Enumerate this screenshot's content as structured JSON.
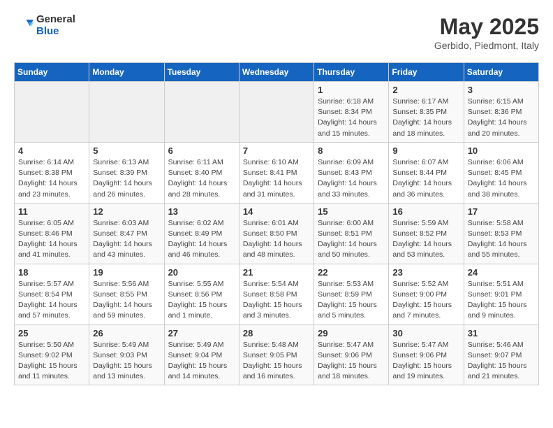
{
  "logo": {
    "general": "General",
    "blue": "Blue"
  },
  "title": "May 2025",
  "subtitle": "Gerbido, Piedmont, Italy",
  "days_of_week": [
    "Sunday",
    "Monday",
    "Tuesday",
    "Wednesday",
    "Thursday",
    "Friday",
    "Saturday"
  ],
  "weeks": [
    [
      {
        "day": "",
        "info": ""
      },
      {
        "day": "",
        "info": ""
      },
      {
        "day": "",
        "info": ""
      },
      {
        "day": "",
        "info": ""
      },
      {
        "day": "1",
        "info": "Sunrise: 6:18 AM\nSunset: 8:34 PM\nDaylight: 14 hours\nand 15 minutes."
      },
      {
        "day": "2",
        "info": "Sunrise: 6:17 AM\nSunset: 8:35 PM\nDaylight: 14 hours\nand 18 minutes."
      },
      {
        "day": "3",
        "info": "Sunrise: 6:15 AM\nSunset: 8:36 PM\nDaylight: 14 hours\nand 20 minutes."
      }
    ],
    [
      {
        "day": "4",
        "info": "Sunrise: 6:14 AM\nSunset: 8:38 PM\nDaylight: 14 hours\nand 23 minutes."
      },
      {
        "day": "5",
        "info": "Sunrise: 6:13 AM\nSunset: 8:39 PM\nDaylight: 14 hours\nand 26 minutes."
      },
      {
        "day": "6",
        "info": "Sunrise: 6:11 AM\nSunset: 8:40 PM\nDaylight: 14 hours\nand 28 minutes."
      },
      {
        "day": "7",
        "info": "Sunrise: 6:10 AM\nSunset: 8:41 PM\nDaylight: 14 hours\nand 31 minutes."
      },
      {
        "day": "8",
        "info": "Sunrise: 6:09 AM\nSunset: 8:43 PM\nDaylight: 14 hours\nand 33 minutes."
      },
      {
        "day": "9",
        "info": "Sunrise: 6:07 AM\nSunset: 8:44 PM\nDaylight: 14 hours\nand 36 minutes."
      },
      {
        "day": "10",
        "info": "Sunrise: 6:06 AM\nSunset: 8:45 PM\nDaylight: 14 hours\nand 38 minutes."
      }
    ],
    [
      {
        "day": "11",
        "info": "Sunrise: 6:05 AM\nSunset: 8:46 PM\nDaylight: 14 hours\nand 41 minutes."
      },
      {
        "day": "12",
        "info": "Sunrise: 6:03 AM\nSunset: 8:47 PM\nDaylight: 14 hours\nand 43 minutes."
      },
      {
        "day": "13",
        "info": "Sunrise: 6:02 AM\nSunset: 8:49 PM\nDaylight: 14 hours\nand 46 minutes."
      },
      {
        "day": "14",
        "info": "Sunrise: 6:01 AM\nSunset: 8:50 PM\nDaylight: 14 hours\nand 48 minutes."
      },
      {
        "day": "15",
        "info": "Sunrise: 6:00 AM\nSunset: 8:51 PM\nDaylight: 14 hours\nand 50 minutes."
      },
      {
        "day": "16",
        "info": "Sunrise: 5:59 AM\nSunset: 8:52 PM\nDaylight: 14 hours\nand 53 minutes."
      },
      {
        "day": "17",
        "info": "Sunrise: 5:58 AM\nSunset: 8:53 PM\nDaylight: 14 hours\nand 55 minutes."
      }
    ],
    [
      {
        "day": "18",
        "info": "Sunrise: 5:57 AM\nSunset: 8:54 PM\nDaylight: 14 hours\nand 57 minutes."
      },
      {
        "day": "19",
        "info": "Sunrise: 5:56 AM\nSunset: 8:55 PM\nDaylight: 14 hours\nand 59 minutes."
      },
      {
        "day": "20",
        "info": "Sunrise: 5:55 AM\nSunset: 8:56 PM\nDaylight: 15 hours\nand 1 minute."
      },
      {
        "day": "21",
        "info": "Sunrise: 5:54 AM\nSunset: 8:58 PM\nDaylight: 15 hours\nand 3 minutes."
      },
      {
        "day": "22",
        "info": "Sunrise: 5:53 AM\nSunset: 8:59 PM\nDaylight: 15 hours\nand 5 minutes."
      },
      {
        "day": "23",
        "info": "Sunrise: 5:52 AM\nSunset: 9:00 PM\nDaylight: 15 hours\nand 7 minutes."
      },
      {
        "day": "24",
        "info": "Sunrise: 5:51 AM\nSunset: 9:01 PM\nDaylight: 15 hours\nand 9 minutes."
      }
    ],
    [
      {
        "day": "25",
        "info": "Sunrise: 5:50 AM\nSunset: 9:02 PM\nDaylight: 15 hours\nand 11 minutes."
      },
      {
        "day": "26",
        "info": "Sunrise: 5:49 AM\nSunset: 9:03 PM\nDaylight: 15 hours\nand 13 minutes."
      },
      {
        "day": "27",
        "info": "Sunrise: 5:49 AM\nSunset: 9:04 PM\nDaylight: 15 hours\nand 14 minutes."
      },
      {
        "day": "28",
        "info": "Sunrise: 5:48 AM\nSunset: 9:05 PM\nDaylight: 15 hours\nand 16 minutes."
      },
      {
        "day": "29",
        "info": "Sunrise: 5:47 AM\nSunset: 9:06 PM\nDaylight: 15 hours\nand 18 minutes."
      },
      {
        "day": "30",
        "info": "Sunrise: 5:47 AM\nSunset: 9:06 PM\nDaylight: 15 hours\nand 19 minutes."
      },
      {
        "day": "31",
        "info": "Sunrise: 5:46 AM\nSunset: 9:07 PM\nDaylight: 15 hours\nand 21 minutes."
      }
    ]
  ]
}
